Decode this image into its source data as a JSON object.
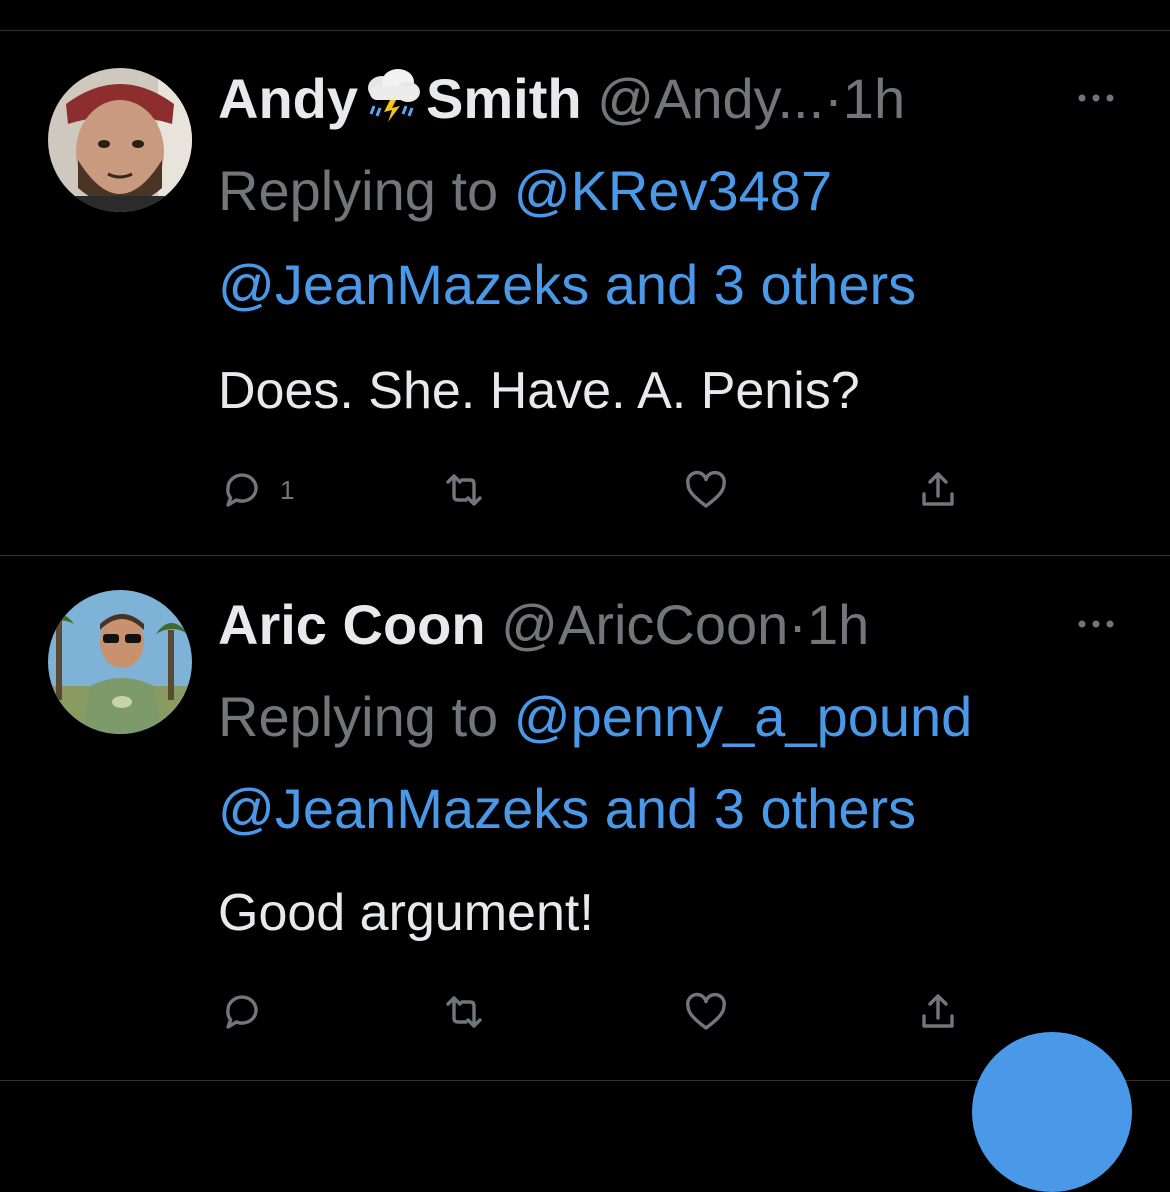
{
  "tweets": [
    {
      "display_name_first": "Andy",
      "display_name_emoji": "cloud-with-lightning-and-rain-emoji",
      "display_name_last": "Smith",
      "handle": "@Andy...",
      "separator": "·",
      "time": "1h",
      "reply_prefix": "Replying to",
      "reply_to_first": "@KRev3487",
      "reply_to_rest": "@JeanMazeks and 3 others",
      "text": "Does. She. Have. A. Penis?",
      "reply_count": "1"
    },
    {
      "display_name": "Aric Coon",
      "handle": "@AricCoon",
      "separator": "·",
      "time": "1h",
      "reply_prefix": "Replying to",
      "reply_to_first": "@penny_a_pound",
      "reply_to_rest": "@JeanMazeks and 3 others",
      "text": "Good argument!",
      "reply_count": ""
    }
  ],
  "icons": {
    "more": "more-horizontal-icon",
    "reply": "reply-icon",
    "retweet": "retweet-icon",
    "like": "heart-icon",
    "share": "share-icon",
    "compose": "compose-fab"
  },
  "colors": {
    "background": "#000000",
    "primary_text": "#e7e9ea",
    "secondary_text": "#71767b",
    "link": "#4a99e9",
    "divider": "#2f3336",
    "fab": "#4a99e9"
  }
}
